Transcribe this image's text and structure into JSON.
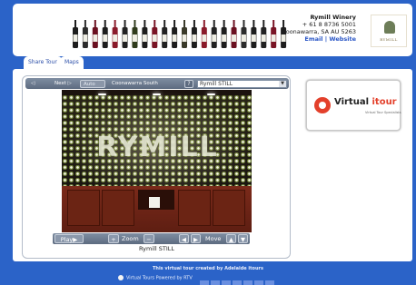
{
  "winery": {
    "name": "Rymill Winery",
    "phone": "+ 61 8 8736 5001",
    "address": "Coonawarra, SA AU  5263",
    "email_link": "Email",
    "separator": "|",
    "website_link": "Website",
    "logo_text": "RYMILL"
  },
  "tabs": [
    {
      "label": "Share Tour"
    },
    {
      "label": "Maps"
    }
  ],
  "toolbar": {
    "back_label": "◁ Back",
    "next_label": "Next ▷",
    "auto_label": "Auto ◁▷",
    "region_label": "Coonawarra South Australia",
    "help_label": "?",
    "scene_select_value": "Rymill STILL"
  },
  "scene": {
    "wall_word": "RYMILL",
    "caption": "Rymill STILL"
  },
  "controls": {
    "play_label": "Play▶",
    "zoom_in_label": "+",
    "zoom_label": "Zoom",
    "zoom_out_label": "−",
    "move_left_label": "◀",
    "move_right_label": "▶",
    "move_label": "Move",
    "move_up_label": "▲",
    "move_down_label": "▼"
  },
  "ad": {
    "brand_main": "Virtual ",
    "brand_accent": "itour",
    "tagline": "Virtual Tour Specialists"
  },
  "footer": {
    "credit": "This virtual tour created by Adelaide itours",
    "powered": "Virtual Tours Powered by RTV"
  },
  "colors": {
    "background": "#2b63c8",
    "toolbar": "#5d6b80",
    "link": "#2a56c6",
    "accent": "#e3402b"
  }
}
